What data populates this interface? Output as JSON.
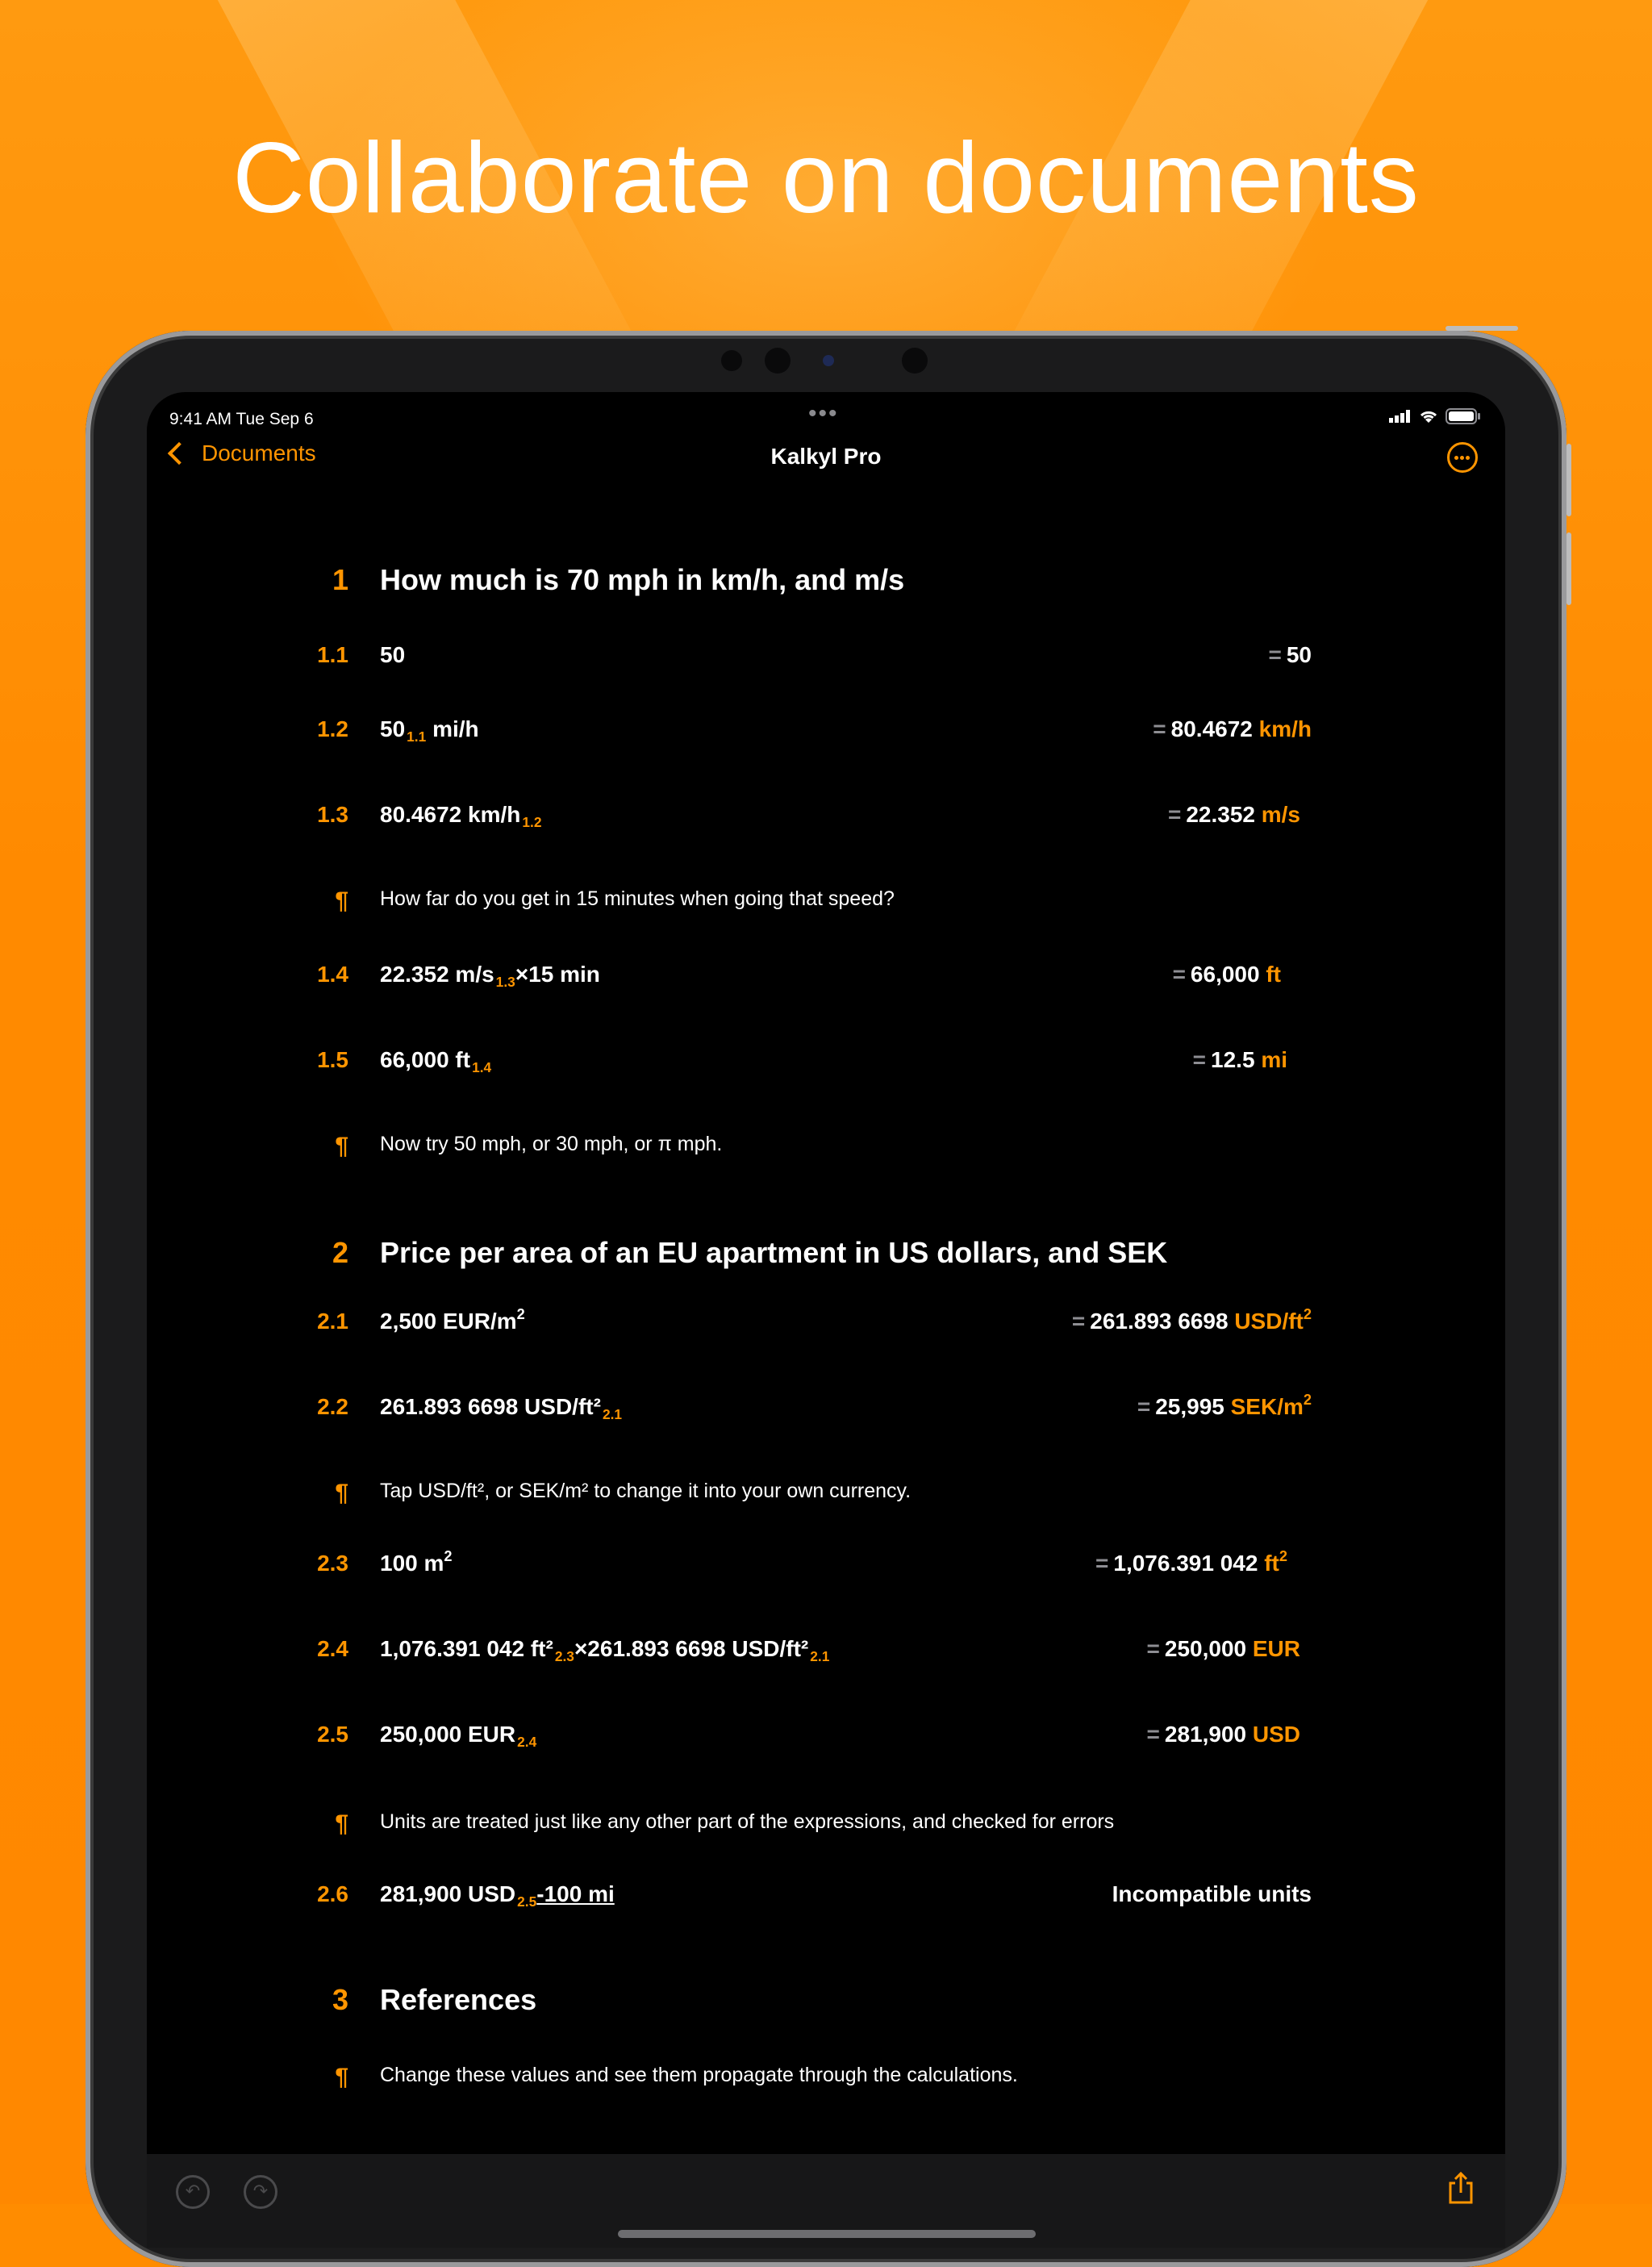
{
  "headline": "Collaborate on documents",
  "status": {
    "time": "9:41 AM   Tue Sep 6"
  },
  "nav": {
    "back_label": "Documents",
    "title": "Kalkyl Pro"
  },
  "sections": [
    {
      "number": "1",
      "title": "How much is 70 mph in km/h, and m/s"
    },
    {
      "number": "2",
      "title": "Price per area of an EU apartment in US dollars, and SEK"
    },
    {
      "number": "3",
      "title": "References"
    }
  ],
  "lines": {
    "l1_1": {
      "number": "1.1",
      "expr": "50",
      "result": "50"
    },
    "l1_2": {
      "number": "1.2",
      "expr": "50",
      "ref": "1.1",
      "expr_unit": " mi/h",
      "result": "80.4672",
      "result_unit": "km/h"
    },
    "l1_3": {
      "number": "1.3",
      "expr": "80.4672 km/h",
      "ref": "1.2",
      "result": "22.352",
      "result_unit": "m/s"
    },
    "n1": {
      "mark": "¶",
      "text": "How far do you get in 15 minutes when going that speed?"
    },
    "l1_4": {
      "number": "1.4",
      "expr": "22.352 m/s",
      "ref": "1.3",
      "expr_tail": "×15 min",
      "result": "66,000",
      "result_unit": "ft"
    },
    "l1_5": {
      "number": "1.5",
      "expr": "66,000 ft",
      "ref": "1.4",
      "result": "12.5",
      "result_unit": "mi"
    },
    "n2": {
      "mark": "¶",
      "text": "Now try 50 mph, or 30 mph, or π mph."
    },
    "l2_1": {
      "number": "2.1",
      "expr": "2,500 EUR/m",
      "sup": "2",
      "result": "261.893 6698",
      "result_unit": "USD/ft",
      "result_sup": "2"
    },
    "l2_2": {
      "number": "2.2",
      "expr": "261.893 6698 USD/ft²",
      "ref": "2.1",
      "result": "25,995",
      "result_unit": "SEK/m",
      "result_sup": "2"
    },
    "n3": {
      "mark": "¶",
      "text": "Tap USD/ft², or SEK/m² to change it into your own currency."
    },
    "l2_3": {
      "number": "2.3",
      "expr": "100 m",
      "sup": "2",
      "result": "1,076.391 042",
      "result_unit": "ft",
      "result_sup": "2"
    },
    "l2_4": {
      "number": "2.4",
      "expr": "1,076.391 042 ft²",
      "ref": "2.3",
      "expr_tail": "×261.893 6698 USD/ft²",
      "ref2": "2.1",
      "result": "250,000",
      "result_unit": "EUR"
    },
    "l2_5": {
      "number": "2.5",
      "expr": "250,000 EUR",
      "ref": "2.4",
      "result": "281,900",
      "result_unit": "USD"
    },
    "n4": {
      "mark": "¶",
      "text": "Units are treated just like any other part of the expressions, and checked for errors"
    },
    "l2_6": {
      "number": "2.6",
      "expr": "281,900 USD",
      "ref": "2.5",
      "expr_tail": "-100 mi",
      "result": "Incompatible units"
    },
    "n5": {
      "mark": "¶",
      "text": "Change these values and see them propagate through the calculations."
    }
  },
  "equals_sign": "=",
  "icons": {
    "back": "chevron-left-icon",
    "more": "ellipsis-circle-icon",
    "undo": "undo-icon",
    "redo": "redo-icon",
    "share": "share-icon"
  },
  "colors": {
    "background": "#ff8c00",
    "accent": "#ff9500",
    "screen": "#000000"
  }
}
